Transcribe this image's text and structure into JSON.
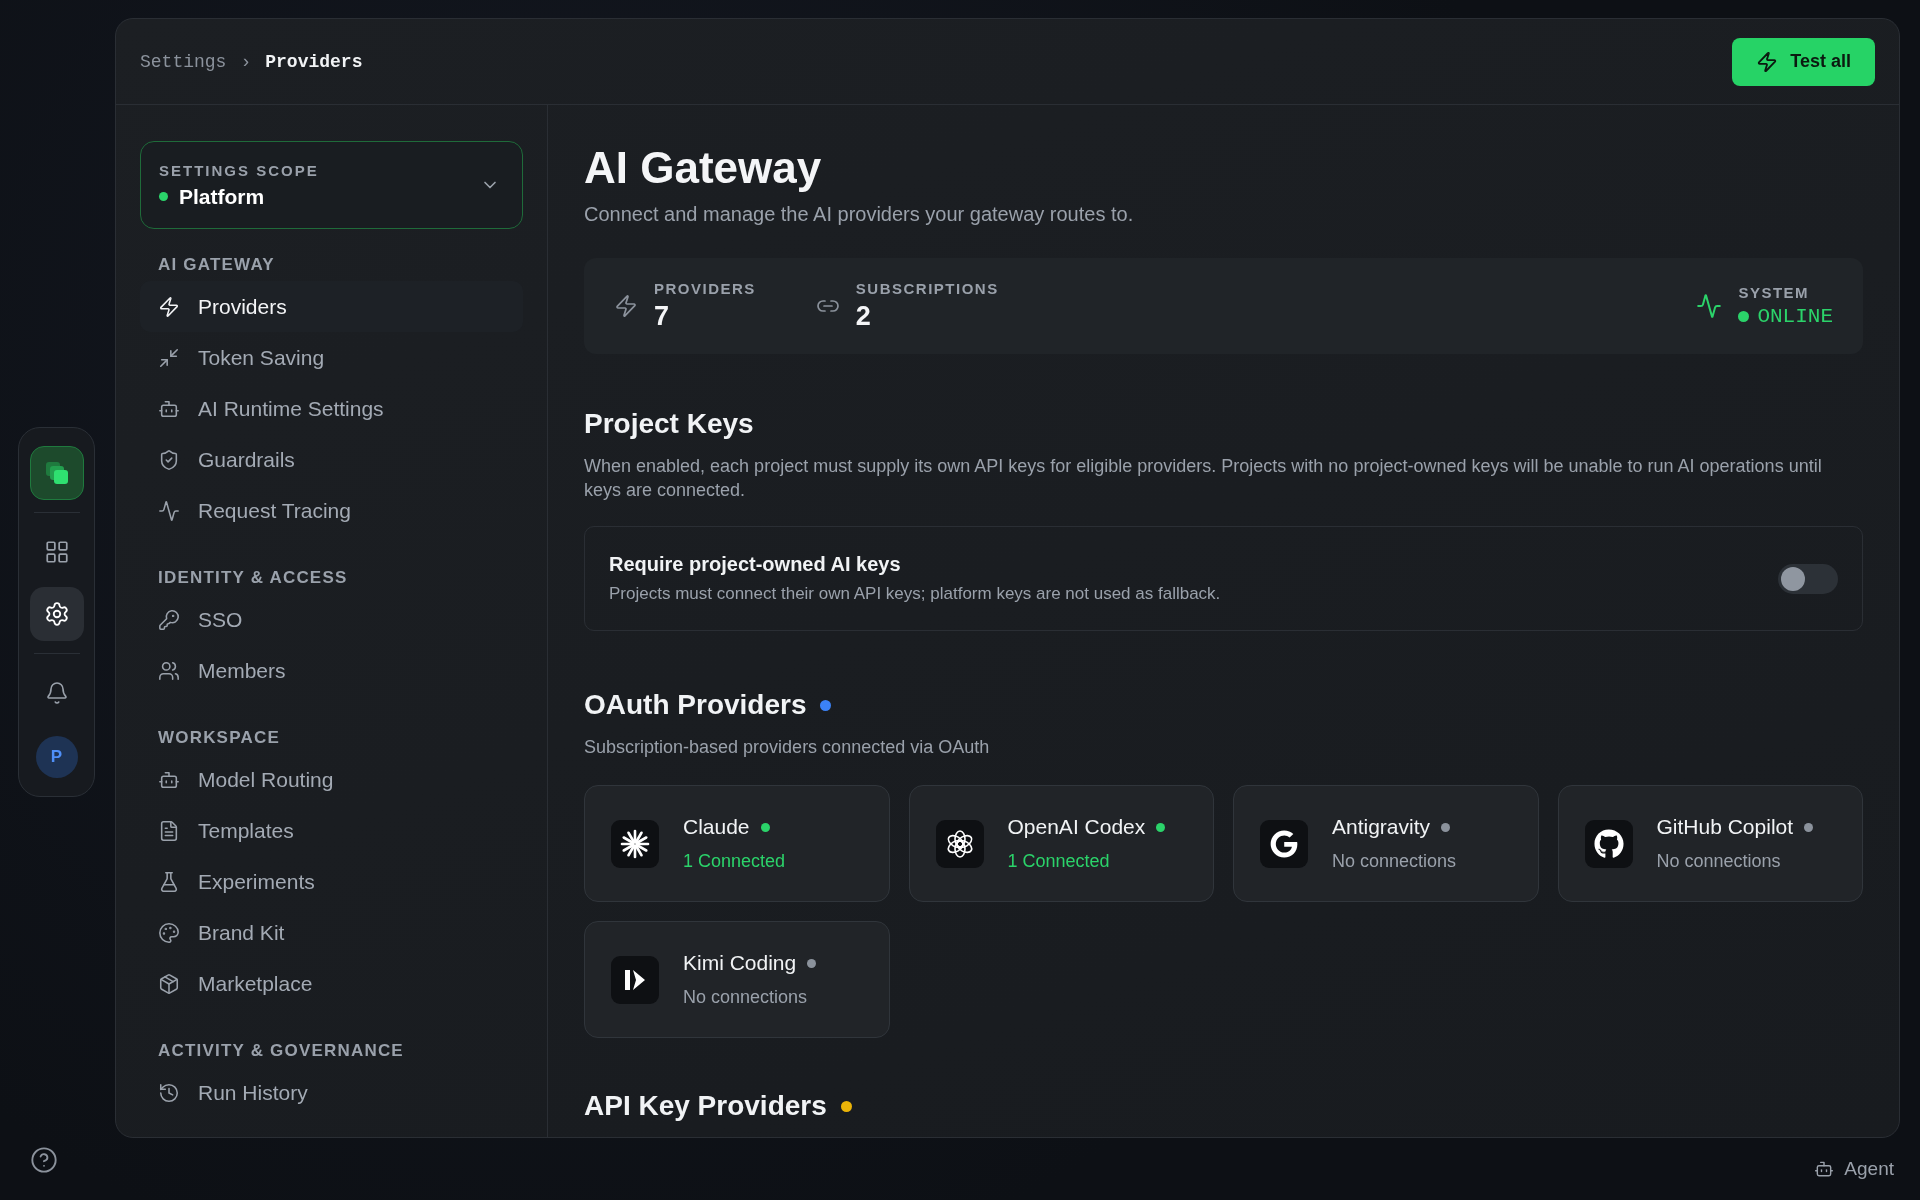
{
  "breadcrumb": {
    "parent": "Settings",
    "separator": "›",
    "current": "Providers"
  },
  "header_action": {
    "label": "Test all"
  },
  "rail": [
    {
      "kind": "apps",
      "selected": false
    },
    {
      "kind": "settings",
      "selected": true
    },
    {
      "kind": "notifications",
      "selected": false
    }
  ],
  "avatar": {
    "initial": "P"
  },
  "scope": {
    "label": "SETTINGS SCOPE",
    "value": "Platform",
    "active": true
  },
  "sidebar": [
    {
      "heading": "AI GATEWAY",
      "items": [
        {
          "label": "Providers",
          "selected": true
        },
        {
          "label": "Token Saving",
          "selected": false
        },
        {
          "label": "AI Runtime Settings",
          "selected": false
        },
        {
          "label": "Guardrails",
          "selected": false
        },
        {
          "label": "Request Tracing",
          "selected": false
        }
      ]
    },
    {
      "heading": "IDENTITY & ACCESS",
      "items": [
        {
          "label": "SSO",
          "selected": false
        },
        {
          "label": "Members",
          "selected": false
        }
      ]
    },
    {
      "heading": "WORKSPACE",
      "items": [
        {
          "label": "Model Routing",
          "selected": false
        },
        {
          "label": "Templates",
          "selected": false
        },
        {
          "label": "Experiments",
          "selected": false
        },
        {
          "label": "Brand Kit",
          "selected": false
        },
        {
          "label": "Marketplace",
          "selected": false
        }
      ]
    },
    {
      "heading": "ACTIVITY & GOVERNANCE",
      "items": [
        {
          "label": "Run History",
          "selected": false
        }
      ]
    }
  ],
  "page": {
    "title": "AI Gateway",
    "subtitle": "Connect and manage the AI providers your gateway routes to."
  },
  "stats": [
    {
      "label": "PROVIDERS",
      "value": "7"
    },
    {
      "label": "SUBSCRIPTIONS",
      "value": "2"
    }
  ],
  "system": {
    "label": "SYSTEM",
    "value": "ONLINE",
    "online": true
  },
  "project_keys": {
    "title": "Project Keys",
    "description": "When enabled, each project must supply its own API keys for eligible providers. Projects with no project-owned keys will be unable to run AI operations until keys are connected.",
    "setting": {
      "title": "Require project-owned AI keys",
      "description": "Projects must connect their own API keys; platform keys are not used as fallback.",
      "on": false
    }
  },
  "oauth": {
    "title": "OAuth Providers",
    "color": "#3b82f6",
    "subtitle": "Subscription-based providers connected via OAuth",
    "providers": [
      {
        "name": "Claude",
        "status": "1 Connected",
        "connected": true
      },
      {
        "name": "OpenAI Codex",
        "status": "1 Connected",
        "connected": true
      },
      {
        "name": "Antigravity",
        "status": "No connections",
        "connected": false
      },
      {
        "name": "GitHub Copilot",
        "status": "No connections",
        "connected": false
      },
      {
        "name": "Kimi Coding",
        "status": "No connections",
        "connected": false
      }
    ]
  },
  "api_key_section": {
    "title": "API Key Providers",
    "color": "#eab308"
  },
  "footer": {
    "label": "Agent"
  }
}
